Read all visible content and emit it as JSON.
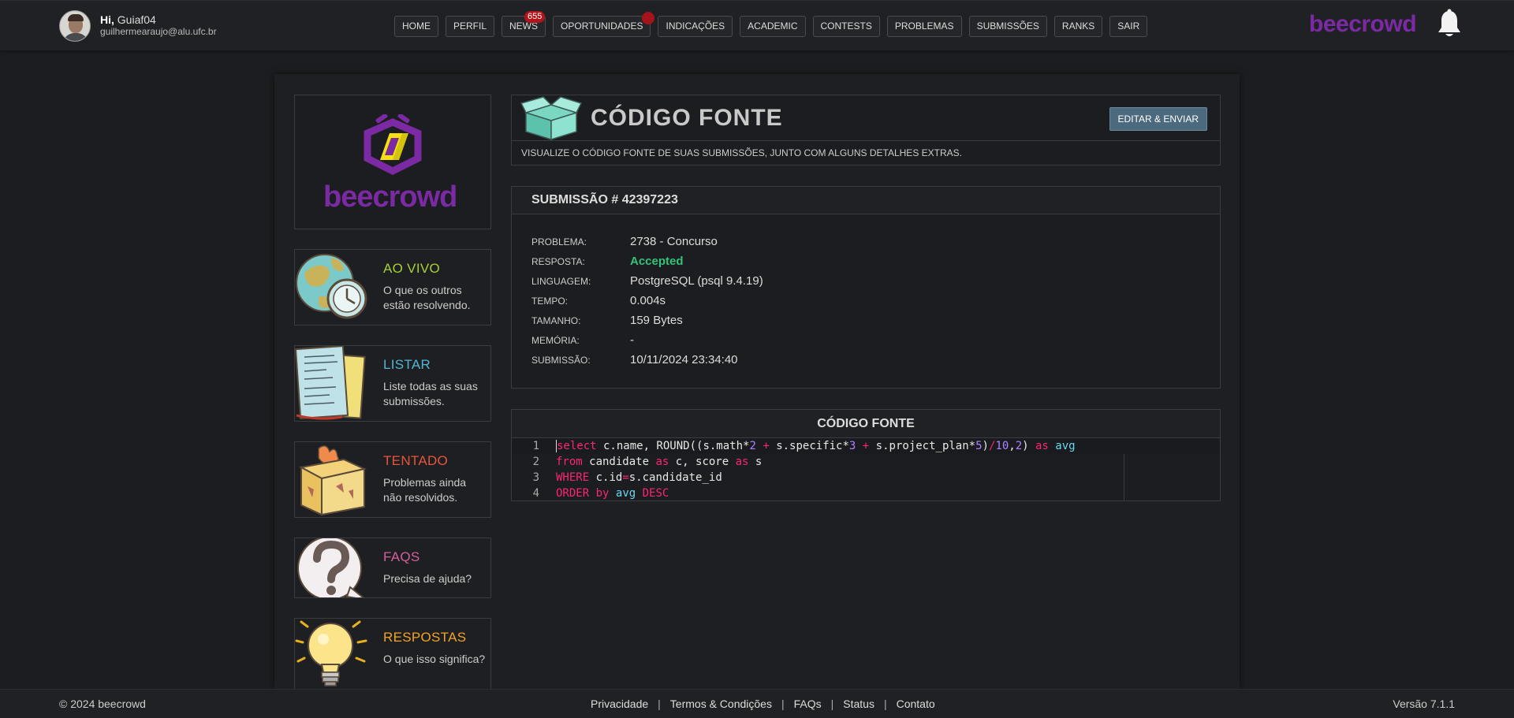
{
  "user": {
    "greeting_bold": "Hi,",
    "name": "Guiaf04",
    "email": "guilhermearaujo@alu.ufc.br"
  },
  "nav": [
    {
      "label": "HOME"
    },
    {
      "label": "PERFIL"
    },
    {
      "label": "NEWS",
      "badge": "655"
    },
    {
      "label": "OPORTUNIDADES"
    },
    {
      "label": "INDICAÇÕES"
    },
    {
      "label": "ACADEMIC"
    },
    {
      "label": "CONTESTS"
    },
    {
      "label": "PROBLEMAS"
    },
    {
      "label": "SUBMISSÕES"
    },
    {
      "label": "RANKS"
    },
    {
      "label": "SAIR"
    }
  ],
  "brand": "beecrowd",
  "sidebar": {
    "logo_text": "beecrowd",
    "cards": [
      {
        "title": "AO VIVO",
        "desc": "O que os outros estão resolvendo.",
        "color": "#a6d133",
        "icon": "globe-clock-icon"
      },
      {
        "title": "LISTAR",
        "desc": "Liste todas as suas submissões.",
        "color": "#4eb7d6",
        "icon": "documents-icon"
      },
      {
        "title": "TENTADO",
        "desc": "Problemas ainda não resolvidos.",
        "color": "#e8553a",
        "icon": "burning-box-icon"
      },
      {
        "title": "FAQS",
        "desc": "Precisa de ajuda?",
        "color": "#d35f9b",
        "icon": "question-mark-icon"
      },
      {
        "title": "RESPOSTAS",
        "desc": "O que isso significa?",
        "color": "#f4a321",
        "icon": "light-bulb-icon"
      }
    ]
  },
  "header": {
    "title": "CÓDIGO FONTE",
    "edit_label": "EDITAR & ENVIAR",
    "subtitle": "VISUALIZE O CÓDIGO FONTE DE SUAS SUBMISSÕES, JUNTO COM ALGUNS DETALHES EXTRAS."
  },
  "submission": {
    "title": "SUBMISSÃO # 42397223",
    "rows": [
      {
        "label": "PROBLEMA:",
        "value": "2738 - Concurso"
      },
      {
        "label": "RESPOSTA:",
        "value": "Accepted"
      },
      {
        "label": "LINGUAGEM:",
        "value": "PostgreSQL (psql 9.4.19)"
      },
      {
        "label": "TEMPO:",
        "value": "0.004s"
      },
      {
        "label": "TAMANHO:",
        "value": "159 Bytes"
      },
      {
        "label": "MEMÓRIA:",
        "value": "-"
      },
      {
        "label": "SUBMISSÃO:",
        "value": "10/11/2024 23:34:40"
      }
    ]
  },
  "code": {
    "title": "CÓDIGO FONTE",
    "line_numbers": [
      "1",
      "2",
      "3",
      "4"
    ],
    "lines": [
      "select c.name, ROUND((s.math*2 + s.specific*3 + s.project_plan*5)/10,2) as avg",
      "from candidate as c, score as s",
      "WHERE c.id=s.candidate_id",
      "ORDER by avg DESC"
    ]
  },
  "footer": {
    "copyright": "© 2024 beecrowd",
    "links": [
      "Privacidade",
      "Termos & Condições",
      "FAQs",
      "Status",
      "Contato"
    ],
    "separator": "|",
    "version": "Versão 7.1.1"
  }
}
